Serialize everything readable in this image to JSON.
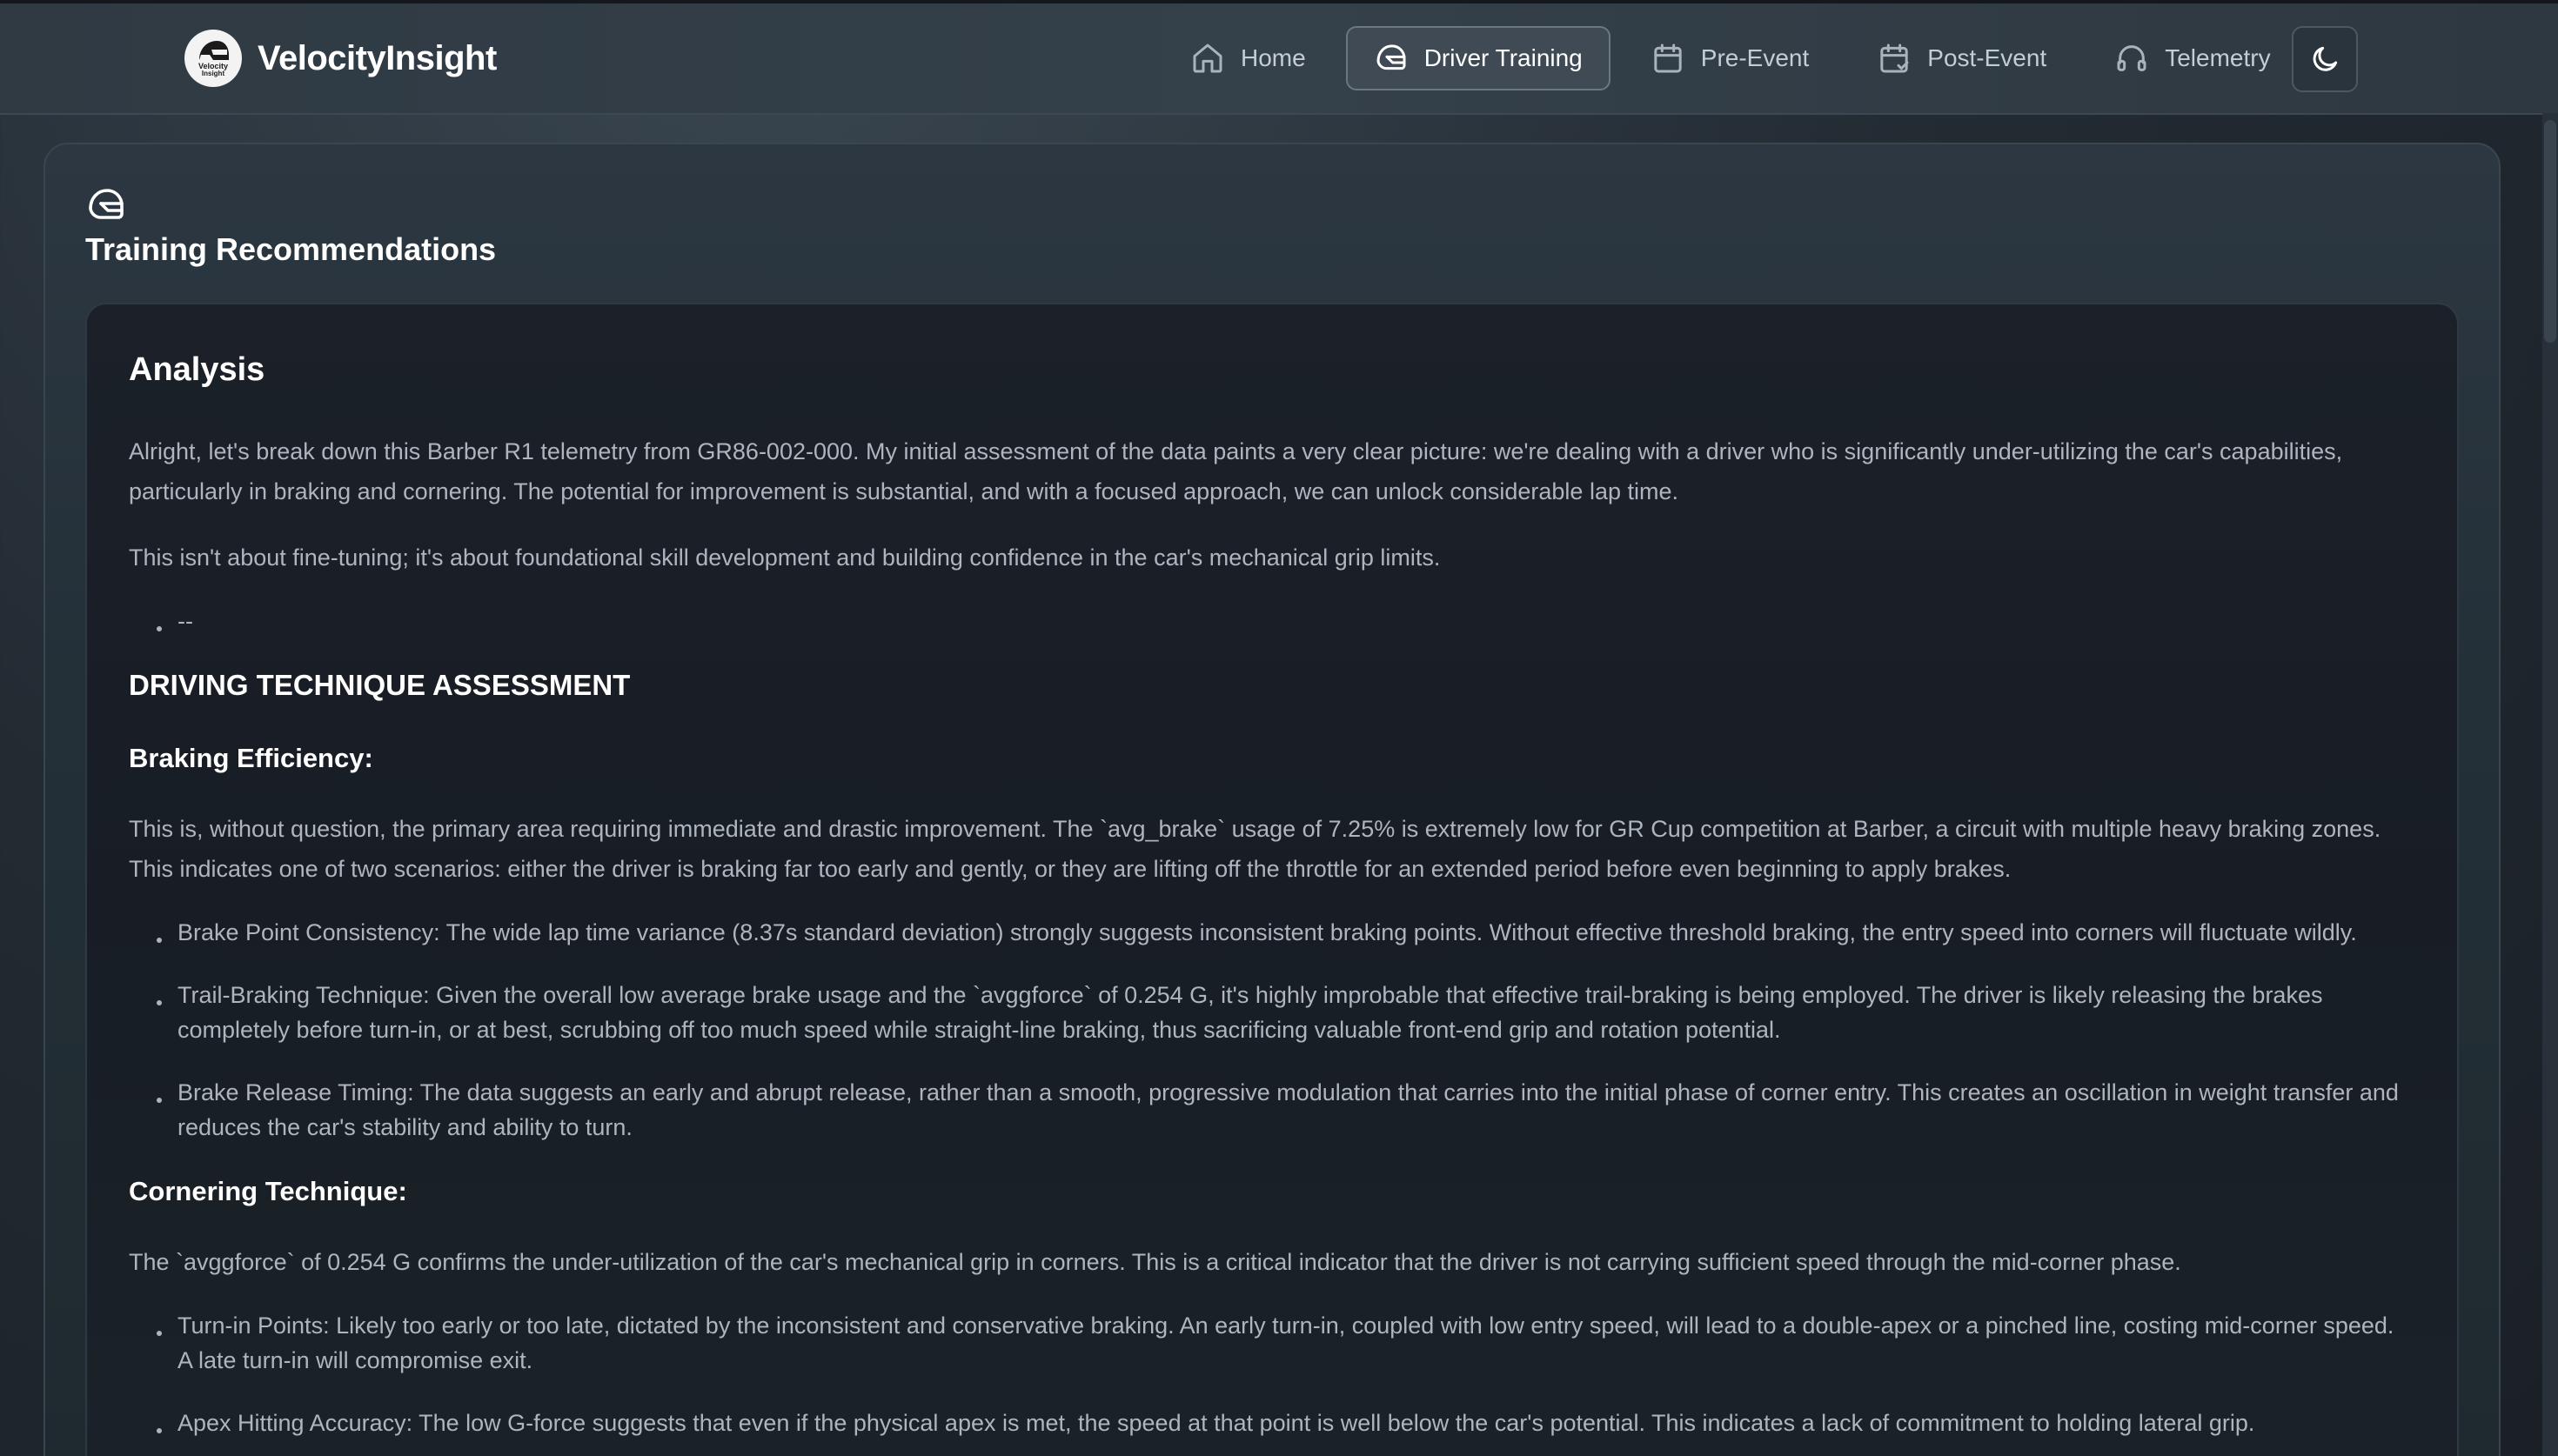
{
  "header": {
    "brand": "VelocityInsight",
    "logo_text": "Velocity Insight",
    "nav": [
      {
        "label": "Home",
        "icon": "home-icon",
        "active": false
      },
      {
        "label": "Driver Training",
        "icon": "helmet-icon",
        "active": true
      },
      {
        "label": "Pre-Event",
        "icon": "calendar-icon",
        "active": false
      },
      {
        "label": "Post-Event",
        "icon": "calendar-check-icon",
        "active": false
      },
      {
        "label": "Telemetry",
        "icon": "headset-icon",
        "active": false
      }
    ],
    "theme_toggle_icon": "moon-icon"
  },
  "section": {
    "icon": "helmet-icon",
    "title": "Training Recommendations"
  },
  "analysis": {
    "heading": "Analysis",
    "intro_1": "Alright, let's break down this Barber R1 telemetry from GR86-002-000. My initial assessment of the data paints a very clear picture: we're dealing with a driver who is significantly under-utilizing the car's capabilities, particularly in braking and cornering. The potential for improvement is substantial, and with a focused approach, we can unlock considerable lap time.",
    "intro_2": "This isn't about fine-tuning; it's about foundational skill development and building confidence in the car's mechanical grip limits.",
    "separator_bullet": "--",
    "assessment_heading": "DRIVING TECHNIQUE ASSESSMENT",
    "braking": {
      "heading": "Braking Efficiency:",
      "text": "This is, without question, the primary area requiring immediate and drastic improvement. The `avg_brake` usage of 7.25% is extremely low for GR Cup competition at Barber, a circuit with multiple heavy braking zones. This indicates one of two scenarios: either the driver is braking far too early and gently, or they are lifting off the throttle for an extended period before even beginning to apply brakes.",
      "bullets": [
        "Brake Point Consistency: The wide lap time variance (8.37s standard deviation) strongly suggests inconsistent braking points. Without effective threshold braking, the entry speed into corners will fluctuate wildly.",
        "Trail-Braking Technique: Given the overall low average brake usage and the `avggforce` of 0.254 G, it's highly improbable that effective trail-braking is being employed. The driver is likely releasing the brakes completely before turn-in, or at best, scrubbing off too much speed while straight-line braking, thus sacrificing valuable front-end grip and rotation potential.",
        "Brake Release Timing: The data suggests an early and abrupt release, rather than a smooth, progressive modulation that carries into the initial phase of corner entry. This creates an oscillation in weight transfer and reduces the car's stability and ability to turn."
      ]
    },
    "cornering": {
      "heading": "Cornering Technique:",
      "text": "The `avggforce` of 0.254 G confirms the under-utilization of the car's mechanical grip in corners. This is a critical indicator that the driver is not carrying sufficient speed through the mid-corner phase.",
      "bullets": [
        "Turn-in Points: Likely too early or too late, dictated by the inconsistent and conservative braking. An early turn-in, coupled with low entry speed, will lead to a double-apex or a pinched line, costing mid-corner speed. A late turn-in will compromise exit.",
        "Apex Hitting Accuracy: The low G-force suggests that even if the physical apex is met, the speed at that point is well below the car's potential. This indicates a lack of commitment to holding lateral grip."
      ]
    }
  }
}
